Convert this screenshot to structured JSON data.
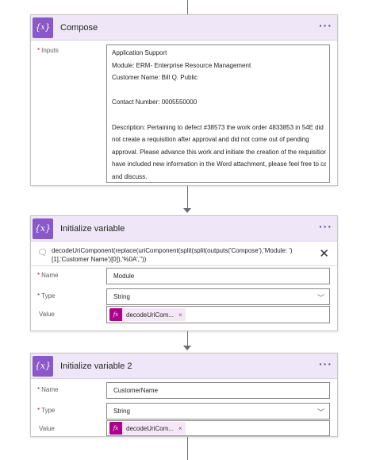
{
  "compose": {
    "title": "Compose",
    "icon": "braces-icon",
    "icon_glyph": "{𝑥}",
    "more_label": "···",
    "inputs_label": "Inputs",
    "lines": [
      "Application Support",
      "Module: ERM- Enterprise Resource Management",
      "Customer Name: Bill Q. Public",
      "",
      "Contact Number: 0005550000",
      "",
      "Description: Pertaining to defect #38573 the work order 4833853 in 54E did",
      "not create a requisition after approval and did not come out of pending",
      "approval. Please advance this work and initiate the creation of the requisition.I",
      "have included new information in the Word attachment, please feel free to call",
      "and discuss."
    ]
  },
  "init_var_1": {
    "title": "Initialize variable",
    "icon_glyph": "{x}",
    "more_label": "···",
    "comment": "decodeUriComponent(replace(uriComponent(split(split(outputs('Compose'),'Module: ')[1],'Customer Name')[0]),'%0A',''))",
    "name_label": "Name",
    "name_value": "Module",
    "type_label": "Type",
    "type_value": "String",
    "value_label": "Value",
    "token_fx": "fx",
    "token_label": "decodeUriCom...",
    "token_remove": "×"
  },
  "init_var_2": {
    "title": "Initialize variable 2",
    "icon_glyph": "{x}",
    "more_label": "···",
    "name_label": "Name",
    "name_value": "CustomerName",
    "type_label": "Type",
    "type_value": "String",
    "value_label": "Value",
    "token_fx": "fx",
    "token_label": "decodeUriCom...",
    "token_remove": "×"
  },
  "colors": {
    "header_bg": "#efe7f7",
    "action_icon": "#8a58c8",
    "fx_token": "#ad008c",
    "required_asterisk": "#a4262c"
  }
}
